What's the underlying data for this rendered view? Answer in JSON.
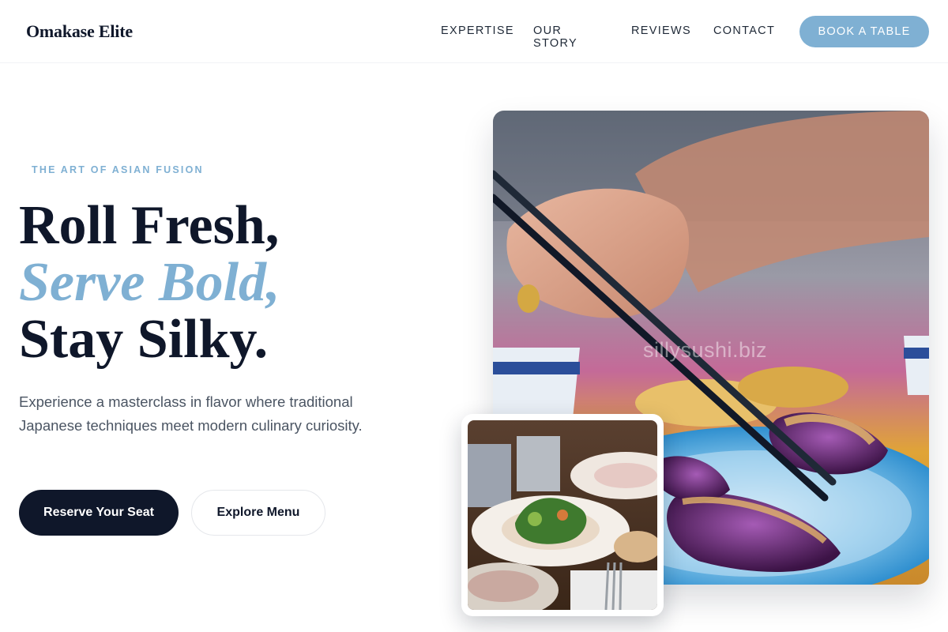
{
  "nav": {
    "brand": "Omakase Elite",
    "links": [
      "EXPERTISE",
      "OUR STORY",
      "REVIEWS",
      "CONTACT"
    ],
    "cta": "BOOK A TABLE"
  },
  "hero": {
    "eyebrow": "THE ART OF ASIAN FUSION",
    "headline": {
      "line1": "Roll Fresh,",
      "line2": "Serve Bold,",
      "line3": "Stay Silky."
    },
    "lede": "Experience a masterclass in flavor where traditional Japanese techniques meet modern culinary curiosity.",
    "primary_cta": "Reserve Your Seat",
    "secondary_cta": "Explore Menu",
    "main_photo": {
      "watermark": "sillysushi.biz",
      "icon": "chopsticks-eggplant-photo"
    },
    "inset_photo": {
      "icon": "plated-dish-photo"
    }
  },
  "colors": {
    "accent": "#7fb0d3",
    "ink": "#0f172a",
    "muted": "#4b5563"
  }
}
